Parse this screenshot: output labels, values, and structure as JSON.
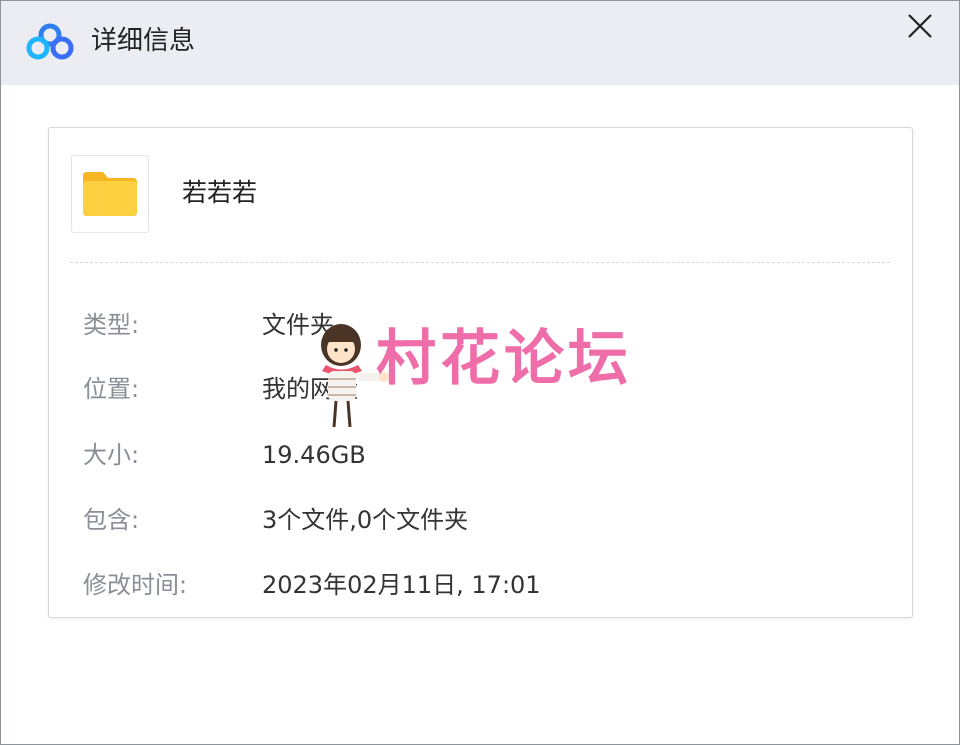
{
  "titlebar": {
    "title": "详细信息",
    "logo_icon": "baidu-netdisk-logo-icon",
    "close_icon": "close-icon"
  },
  "file": {
    "name": "若若若",
    "icon": "folder-icon"
  },
  "properties": [
    {
      "label": "类型:",
      "value": "文件夹"
    },
    {
      "label": "位置:",
      "value": "我的网盘"
    },
    {
      "label": "大小:",
      "value": "19.46GB"
    },
    {
      "label": "包含:",
      "value": "3个文件,0个文件夹"
    },
    {
      "label": "修改时间:",
      "value": "2023年02月11日, 17:01"
    }
  ],
  "watermark": {
    "text": "村花论坛"
  },
  "colors": {
    "titlebar_bg": "#ebedf2",
    "folder_yellow": "#fcd041",
    "watermark_pink": "#ef6da8",
    "label_gray": "#8a8e96"
  }
}
